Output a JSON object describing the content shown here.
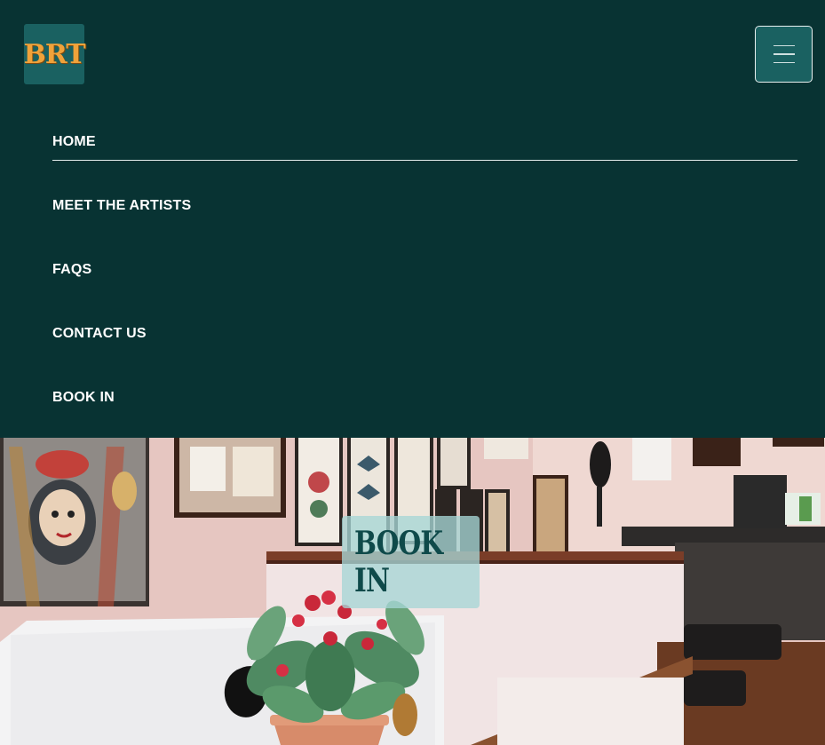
{
  "brand": {
    "logo_text": "BRT",
    "colors": {
      "nav_bg": "#083333",
      "accent": "#1a6161",
      "logo_text": "#f0a23a"
    }
  },
  "menu_toggle": {
    "icon": "hamburger-icon"
  },
  "nav": {
    "items": [
      {
        "label": "HOME",
        "active": true
      },
      {
        "label": "MEET THE ARTISTS",
        "active": false
      },
      {
        "label": "FAQS",
        "active": false
      },
      {
        "label": "CONTACT US",
        "active": false
      },
      {
        "label": "BOOK IN",
        "active": false
      }
    ]
  },
  "hero": {
    "cta_label": "BOOK IN",
    "image": "tattoo-studio-interior-photo"
  }
}
